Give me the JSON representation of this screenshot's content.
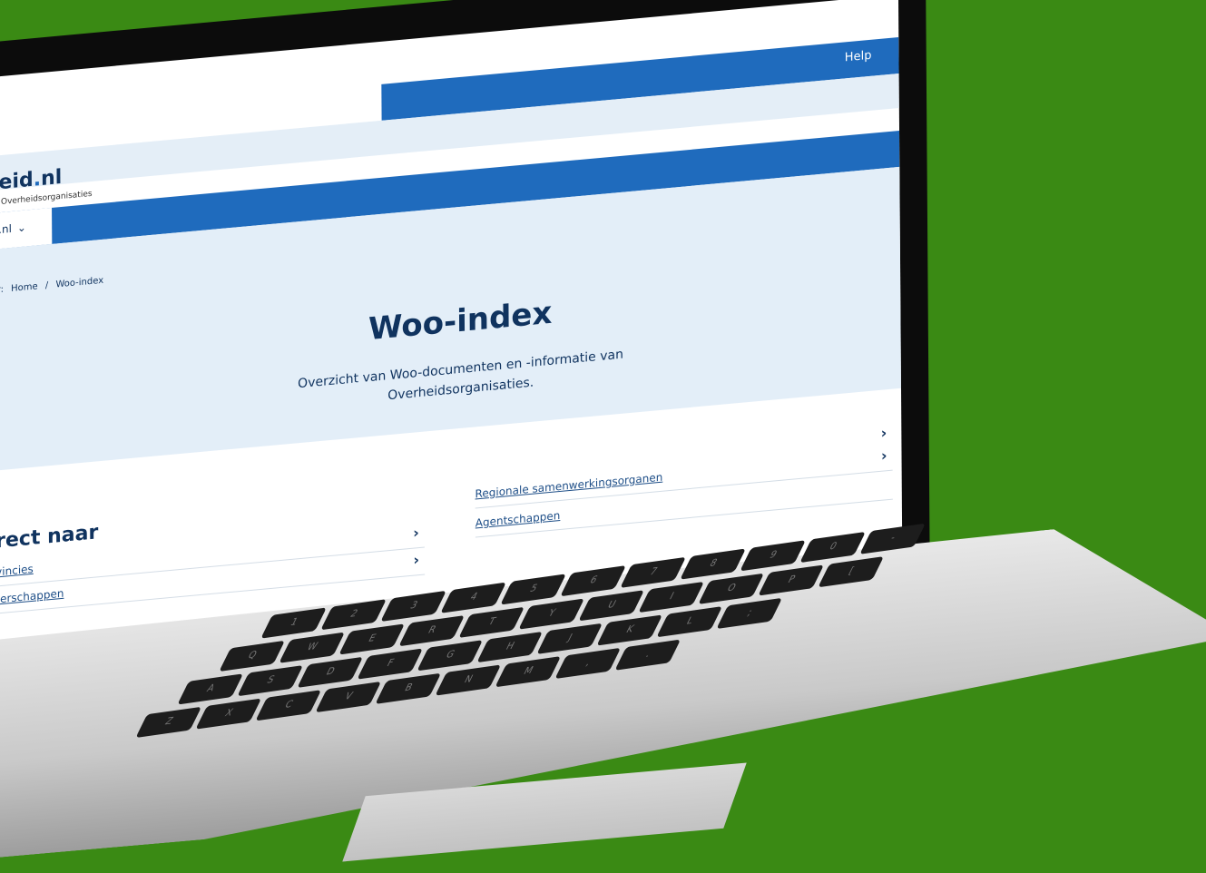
{
  "header": {
    "help_label": "Help",
    "logo_main": "heid",
    "logo_dot": ".",
    "logo_suffix": "nl",
    "logo_subtitle": "Overheidsorganisaties"
  },
  "nav": {
    "selector_label": "id.nl",
    "selector_chevron": "⌄"
  },
  "breadcrumb": {
    "prefix": "r:",
    "items": [
      "Home",
      "/",
      "Woo-index"
    ]
  },
  "hero": {
    "title": "Woo-index",
    "subtitle_line1": "Overzicht van Woo-documenten en -informatie van",
    "subtitle_line2": "Overheidsorganisaties."
  },
  "direct": {
    "title": "irect naar",
    "left_links": [
      {
        "label": "ovincies",
        "chevron": "›"
      },
      {
        "label": "aterschappen",
        "chevron": "›"
      }
    ],
    "right_links": [
      {
        "label": "Regionale samenwerkingsorganen",
        "chevron": "›"
      },
      {
        "label": "Agentschappen",
        "chevron": "›"
      }
    ],
    "top_right_chevron": "›"
  },
  "keyboard": {
    "row1": [
      "",
      "1",
      "2",
      "3",
      "4",
      "5",
      "6",
      "7",
      "8",
      "9",
      "0",
      "-",
      "="
    ],
    "row2": [
      "",
      "Q",
      "W",
      "E",
      "R",
      "T",
      "Y",
      "U",
      "I",
      "O",
      "P",
      "[",
      "]"
    ],
    "row3": [
      "",
      "A",
      "S",
      "D",
      "F",
      "G",
      "H",
      "J",
      "K",
      "L",
      ";",
      "'"
    ],
    "row4": [
      "",
      "Z",
      "X",
      "C",
      "V",
      "B",
      "N",
      "M",
      ",",
      ".",
      "/"
    ]
  },
  "colors": {
    "background": "#3a8a14",
    "brand_blue": "#1f6bbd",
    "dark_blue": "#10335f",
    "hero_bg": "#e3eef8"
  }
}
